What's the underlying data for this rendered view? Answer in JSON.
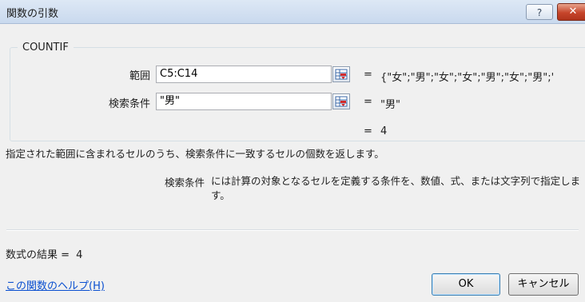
{
  "window": {
    "title": "関数の引数",
    "help_glyph": "?",
    "close_glyph": "✕"
  },
  "function": {
    "name": "COUNTIF"
  },
  "arguments": [
    {
      "label": "範囲",
      "value": "C5:C14",
      "equals": "=",
      "evaluated": "{\"女\";\"男\";\"女\";\"女\";\"男\";\"女\";\"男\";'"
    },
    {
      "label": "検索条件",
      "value": "\"男\"",
      "equals": "=",
      "evaluated": "\"男\""
    }
  ],
  "function_result": {
    "equals": "=",
    "value": "4"
  },
  "description": "指定された範囲に含まれるセルのうち、検索条件に一致するセルの個数を返します。",
  "arg_help": {
    "name": "検索条件",
    "text": "には計算の対象となるセルを定義する条件を、数値、式、または文字列で指定します。"
  },
  "formula_result": {
    "label": "数式の結果 =",
    "value": "4"
  },
  "help_link": "この関数のヘルプ(H)",
  "buttons": {
    "ok": "OK",
    "cancel": "キャンセル"
  },
  "colors": {
    "link": "#0a4fd0",
    "close_button": "#c6452b",
    "title_bar": "#c9d9ee"
  }
}
